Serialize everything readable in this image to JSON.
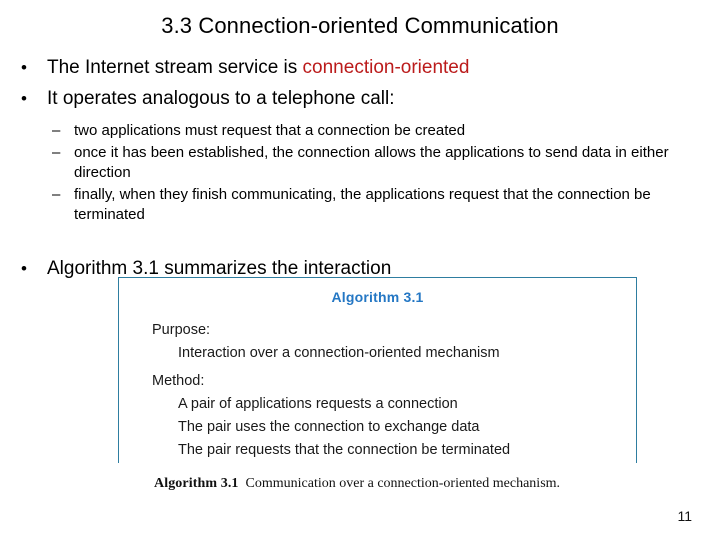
{
  "slide": {
    "title": "3.3  Connection-oriented Communication",
    "page_number": "11"
  },
  "bullets": [
    {
      "marker": "•",
      "text_plain": "The Internet stream service is ",
      "text_accent": "connection-oriented",
      "accent_color": "#BB1B1B"
    },
    {
      "marker": "•",
      "text_plain": "It operates analogous to a telephone call:"
    },
    {
      "marker": "•",
      "text_plain": "Algorithm 3.1 summarizes the interaction"
    }
  ],
  "sub_bullets": [
    {
      "marker": "–",
      "text": "two applications must request that a  connection  be created"
    },
    {
      "marker": "–",
      "text": "once it has been established, the connection allows the applications to send data in either direction"
    },
    {
      "marker": "–",
      "text": "finally, when they finish communicating, the applications request that the connection be terminated"
    }
  ],
  "algorithm_figure": {
    "heading": "Algorithm 3.1",
    "heading_color": "#2477C4",
    "border_color": "#2E7DA0",
    "purpose_label": "Purpose:",
    "purpose_text": "Interaction over a connection-oriented mechanism",
    "method_label": "Method:",
    "method_steps": [
      "A pair of applications requests a connection",
      "The pair uses the connection to exchange data",
      "The pair requests that the connection be terminated"
    ],
    "caption_label": "Algorithm 3.1",
    "caption_text": "Communication over a connection-oriented mechanism."
  }
}
